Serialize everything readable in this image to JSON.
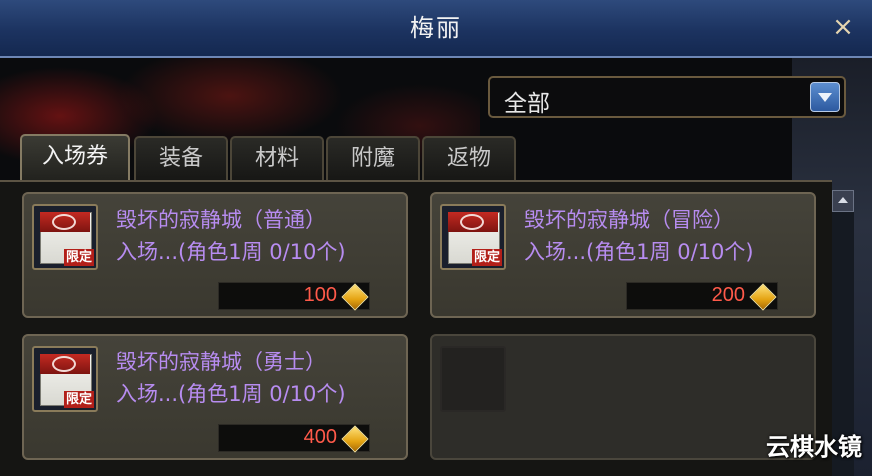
{
  "window": {
    "title": "梅丽",
    "close_icon": "×"
  },
  "filter": {
    "selected": "全部"
  },
  "tabs": [
    {
      "label": "入场券",
      "active": true
    },
    {
      "label": "装备",
      "active": false
    },
    {
      "label": "材料",
      "active": false
    },
    {
      "label": "附魔",
      "active": false
    },
    {
      "label": "返物",
      "active": false
    }
  ],
  "items": [
    {
      "name": "毁坏的寂静城（普通）",
      "desc": "入场...(角色1周  0/10个)",
      "price": "100",
      "badge": "限定"
    },
    {
      "name": "毁坏的寂静城（冒险）",
      "desc": "入场...(角色1周  0/10个)",
      "price": "200",
      "badge": "限定"
    },
    {
      "name": "毁坏的寂静城（勇士）",
      "desc": "入场...(角色1周  0/10个)",
      "price": "400",
      "badge": "限定"
    }
  ],
  "watermark": "云棋水镜",
  "colors": {
    "item_name": "#b78cf0",
    "price": "#ff5a4a",
    "titlebar": "#1c3360"
  }
}
